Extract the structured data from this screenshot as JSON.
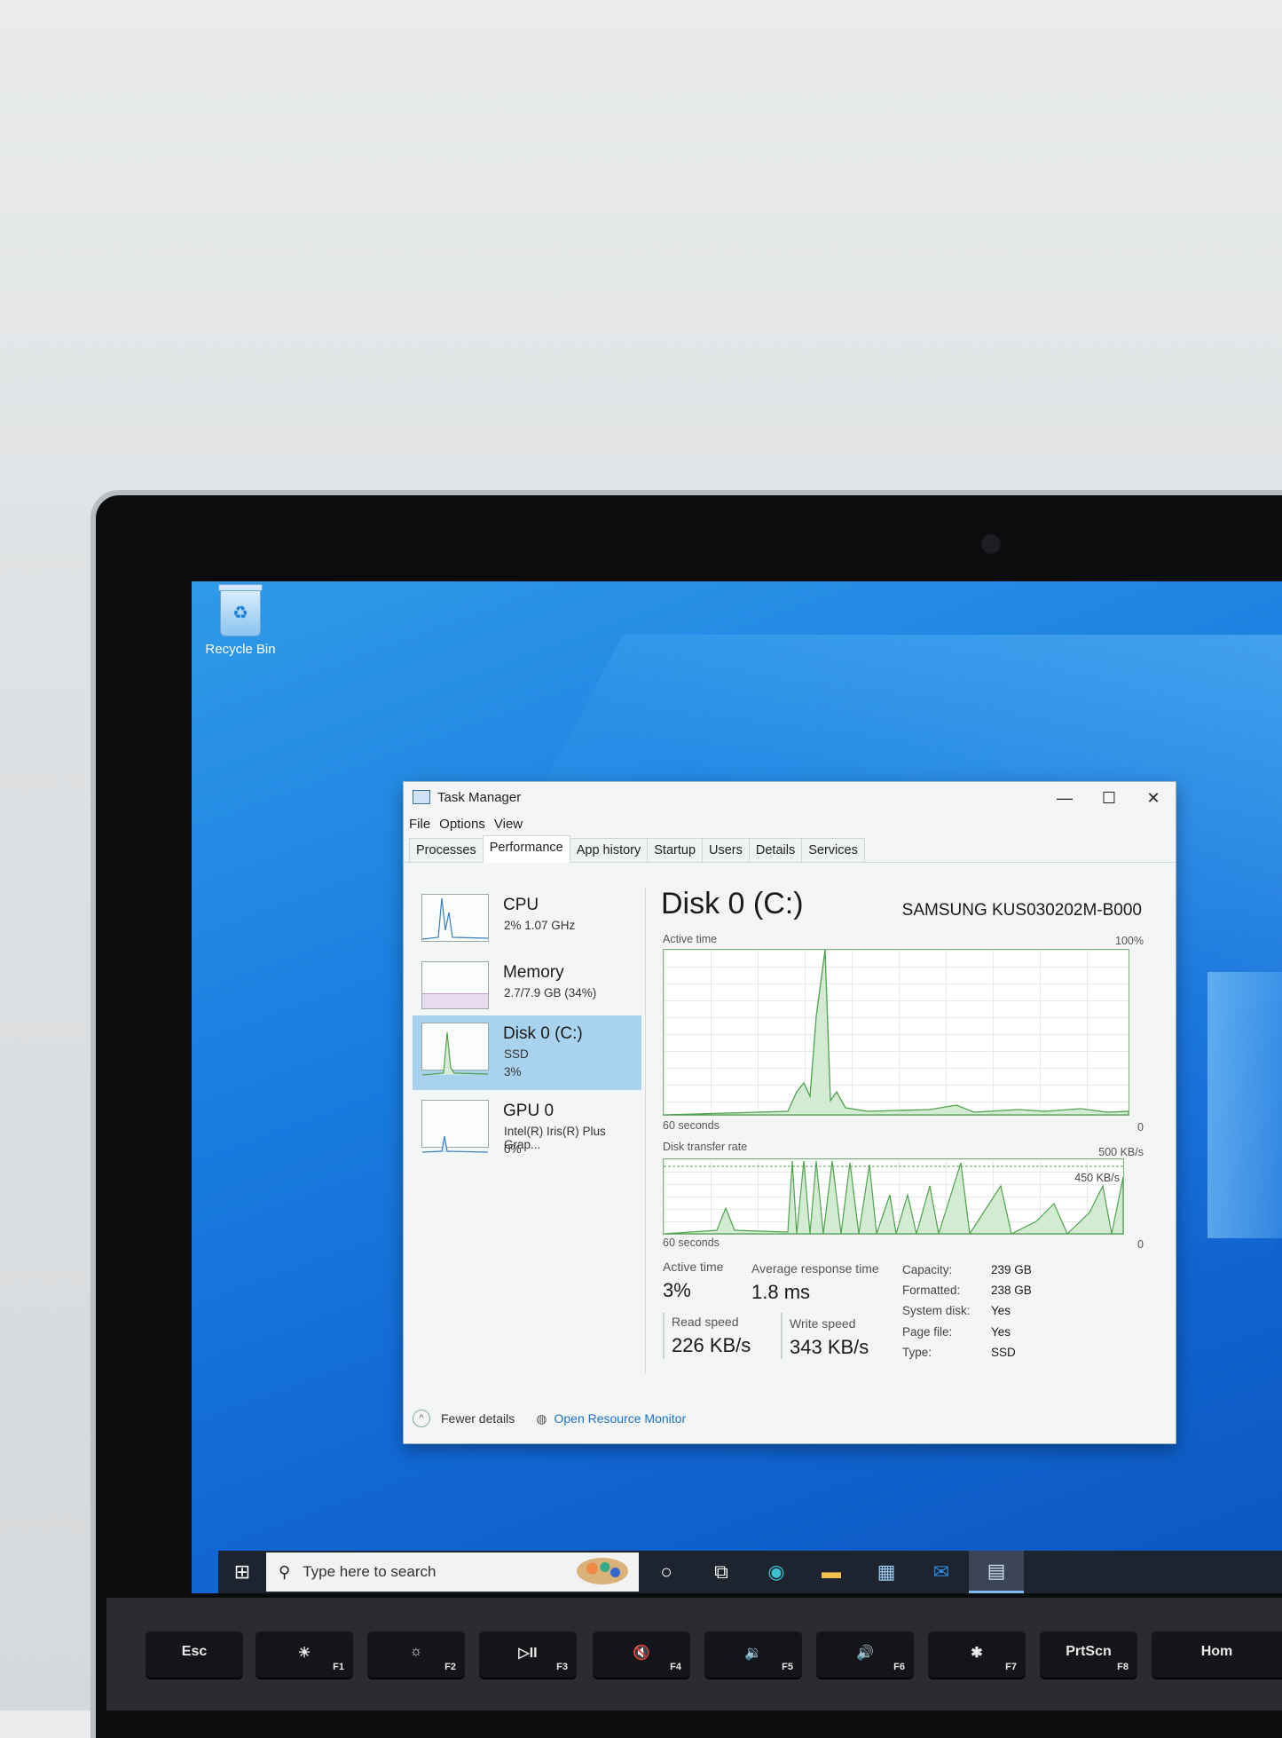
{
  "desktop": {
    "recycle_bin_label": "Recycle Bin"
  },
  "window": {
    "title": "Task Manager",
    "minimize": "—",
    "maximize": "☐",
    "close": "✕"
  },
  "menu": [
    "File",
    "Options",
    "View"
  ],
  "tabs": [
    "Processes",
    "Performance",
    "App history",
    "Startup",
    "Users",
    "Details",
    "Services"
  ],
  "active_tab": "Performance",
  "resources": [
    {
      "name": "CPU",
      "line1": "2% 1.07 GHz",
      "line2": ""
    },
    {
      "name": "Memory",
      "line1": "2.7/7.9 GB (34%)",
      "line2": ""
    },
    {
      "name": "Disk 0 (C:)",
      "line1": "SSD",
      "line2": "3%"
    },
    {
      "name": "GPU 0",
      "line1": "Intel(R) Iris(R) Plus Grap...",
      "line2": "0%"
    }
  ],
  "selected_resource": "Disk 0 (C:)",
  "detail": {
    "title": "Disk 0 (C:)",
    "model": "SAMSUNG KUS030202M-B000",
    "active_time_graph_label": "Active time",
    "active_time_max": "100%",
    "active_time_seconds": "60 seconds",
    "active_time_min": "0",
    "transfer_graph_label": "Disk transfer rate",
    "transfer_max": "500 KB/s",
    "transfer_line": "450 KB/s",
    "transfer_seconds": "60 seconds",
    "transfer_min": "0",
    "stats": {
      "active_time_label": "Active time",
      "active_time_value": "3%",
      "avg_response_label": "Average response time",
      "avg_response_value": "1.8 ms",
      "read_label": "Read speed",
      "read_value": "226 KB/s",
      "write_label": "Write speed",
      "write_value": "343 KB/s"
    },
    "properties": [
      {
        "k": "Capacity:",
        "v": "239 GB"
      },
      {
        "k": "Formatted:",
        "v": "238 GB"
      },
      {
        "k": "System disk:",
        "v": "Yes"
      },
      {
        "k": "Page file:",
        "v": "Yes"
      },
      {
        "k": "Type:",
        "v": "SSD"
      }
    ]
  },
  "footer": {
    "fewer_details": "Fewer details",
    "open_resource_monitor": "Open Resource Monitor"
  },
  "taskbar": {
    "search_placeholder": "Type here to search"
  },
  "keyboard": [
    {
      "label": "Esc",
      "fn": ""
    },
    {
      "label": "☀",
      "fn": "F1"
    },
    {
      "label": "☼",
      "fn": "F2"
    },
    {
      "label": "▷II",
      "fn": "F3"
    },
    {
      "label": "🔇",
      "fn": "F4"
    },
    {
      "label": "🔉",
      "fn": "F5"
    },
    {
      "label": "🔊",
      "fn": "F6"
    },
    {
      "label": "✱",
      "fn": "F7"
    },
    {
      "label": "PrtScn",
      "fn": "F8"
    },
    {
      "label": "Hom",
      "fn": ""
    }
  ],
  "colors": {
    "accent": "#1f6fbf",
    "graph_line": "#4fa24f",
    "graph_fill": "#cfe8cf",
    "selected_bg": "#a9d2ee"
  }
}
